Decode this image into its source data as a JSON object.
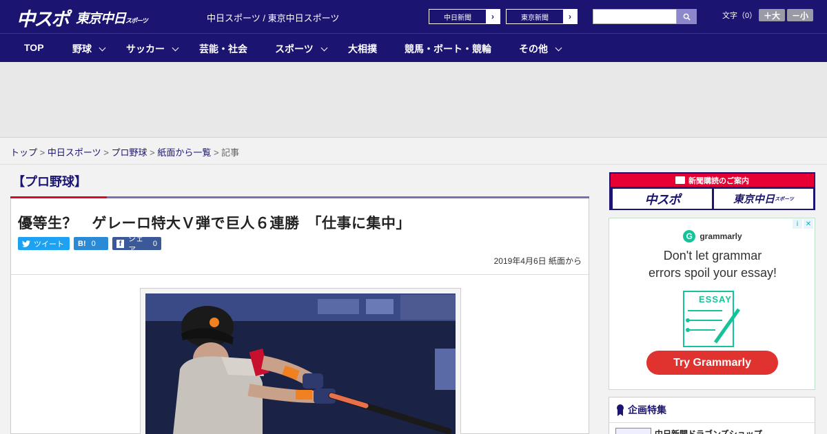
{
  "header": {
    "logo_main": "中スポ",
    "logo_sub": "東京中日",
    "logo_sub_small": "スポーツ",
    "site_name": "中日スポーツ / 東京中日スポーツ",
    "paper_links": [
      {
        "label": "中日新聞"
      },
      {
        "label": "東京新聞"
      }
    ],
    "search_placeholder": "",
    "font_size_label": "文字（0）",
    "font_larger": "＋大",
    "font_smaller": "－小"
  },
  "nav": {
    "items": [
      {
        "label": "TOP",
        "has_menu": false
      },
      {
        "label": "野球",
        "has_menu": true
      },
      {
        "label": "サッカー",
        "has_menu": true
      },
      {
        "label": "芸能・社会",
        "has_menu": false
      },
      {
        "label": "スポーツ",
        "has_menu": true
      },
      {
        "label": "大相撲",
        "has_menu": false
      },
      {
        "label": "競馬・ボート・競輪",
        "has_menu": false
      },
      {
        "label": "その他",
        "has_menu": true
      }
    ]
  },
  "breadcrumb": {
    "items": [
      "トップ",
      "中日スポーツ",
      "プロ野球",
      "紙面から一覧"
    ],
    "current": "記事",
    "separator": ">"
  },
  "article": {
    "category": "【プロ野球】",
    "headline": "優等生？　ゲレーロ特大Ｖ弾で巨人６連勝　「仕事に集中」",
    "share": {
      "tweet_label": "ツイート",
      "hatena_label": "B!",
      "hatena_count": "0",
      "facebook_label": "シェア",
      "facebook_count": "0"
    },
    "date": "2019年4月6日 紙面から"
  },
  "sidebar": {
    "subscribe_title": "新聞購読のご案内",
    "subscribe_left": "中スポ",
    "subscribe_right": "東京中日",
    "subscribe_right_small": "スポーツ",
    "ad": {
      "brand": "grammarly",
      "headline_line1": "Don't let grammar",
      "headline_line2": "errors spoil your essay!",
      "essay_label": "ESSAY",
      "cta": "Try Grammarly"
    },
    "feature_title": "企画特集",
    "feature_item": "中日新聞ドラゴンズショップ"
  },
  "colors": {
    "brand_navy": "#1b1471",
    "accent_red": "#e60033",
    "grammarly_green": "#15c39a",
    "grammarly_red": "#e0322e"
  }
}
